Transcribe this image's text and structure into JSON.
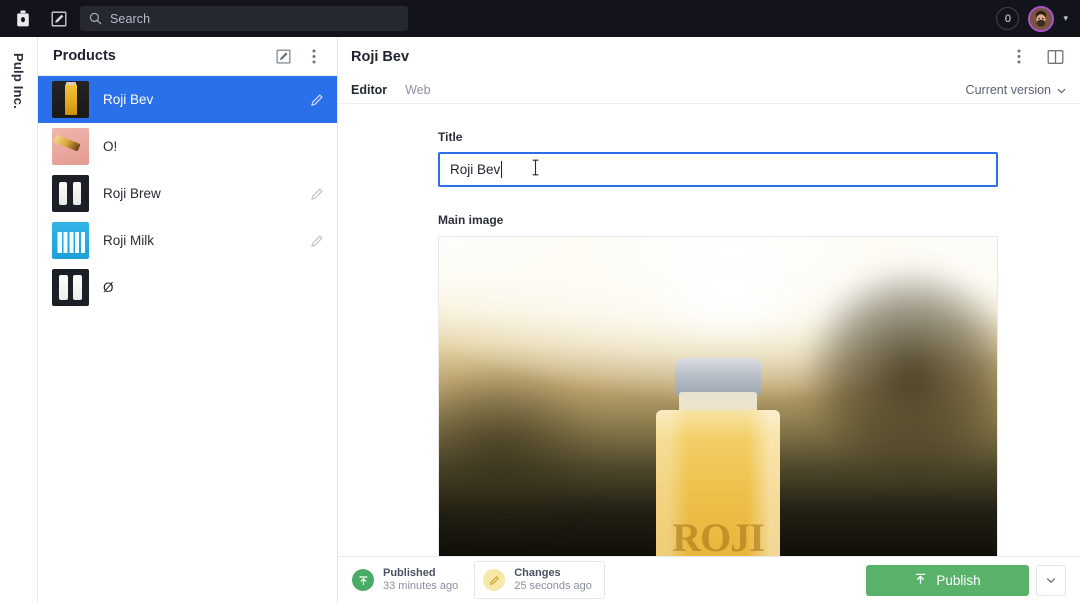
{
  "topbar": {
    "logo_icon": "bottle-logo-icon",
    "compose_icon": "compose-icon",
    "search": {
      "icon": "search-icon",
      "placeholder": "Search",
      "value": ""
    },
    "notification_count": "0",
    "avatar_icon": "user-avatar",
    "account_chevron_icon": "chevron-down-icon"
  },
  "rail": {
    "workspace_title": "Pulp Inc."
  },
  "pane": {
    "title": "Products",
    "compose_icon": "compose-icon",
    "menu_icon": "kebab-menu-icon",
    "items": [
      {
        "label": "Roji Bev",
        "thumb": "t-bev",
        "selected": true,
        "has_pencil": true
      },
      {
        "label": "O!",
        "thumb": "t-o",
        "selected": false,
        "has_pencil": false
      },
      {
        "label": "Roji Brew",
        "thumb": "t-brew",
        "selected": false,
        "has_pencil": true
      },
      {
        "label": "Roji Milk",
        "thumb": "t-milk",
        "selected": false,
        "has_pencil": true
      },
      {
        "label": "Ø",
        "thumb": "t-null",
        "selected": false,
        "has_pencil": false
      }
    ]
  },
  "document": {
    "title": "Roji Bev",
    "menu_icon": "kebab-menu-icon",
    "split_pane_icon": "split-pane-icon",
    "tabs": [
      {
        "label": "Editor",
        "active": true
      },
      {
        "label": "Web",
        "active": false
      }
    ],
    "version_label": "Current version",
    "version_chevron_icon": "chevron-down-icon",
    "fields": {
      "title_label": "Title",
      "title_value": "Roji Bev",
      "title_placeholder": "",
      "image_label": "Main image",
      "image_alt": "Yellow beverage bottle with grey cap at sunset",
      "image_brand_text": "ROJI"
    }
  },
  "bottombar": {
    "published": {
      "icon": "publish-up-arrow-icon",
      "label": "Published",
      "time": "33 minutes ago"
    },
    "changes": {
      "icon": "pencil-icon",
      "label": "Changes",
      "time": "25 seconds ago"
    },
    "publish_button": {
      "icon": "publish-up-arrow-icon",
      "label": "Publish"
    },
    "publish_chevron_icon": "chevron-down-icon"
  },
  "colors": {
    "topbar_bg": "#13141b",
    "selection_blue": "#2a70eb",
    "focus_blue": "#2a70eb",
    "publish_green": "#58b269",
    "changes_yellow": "#f6e8a8",
    "avatar_ring": "#a855c8"
  }
}
